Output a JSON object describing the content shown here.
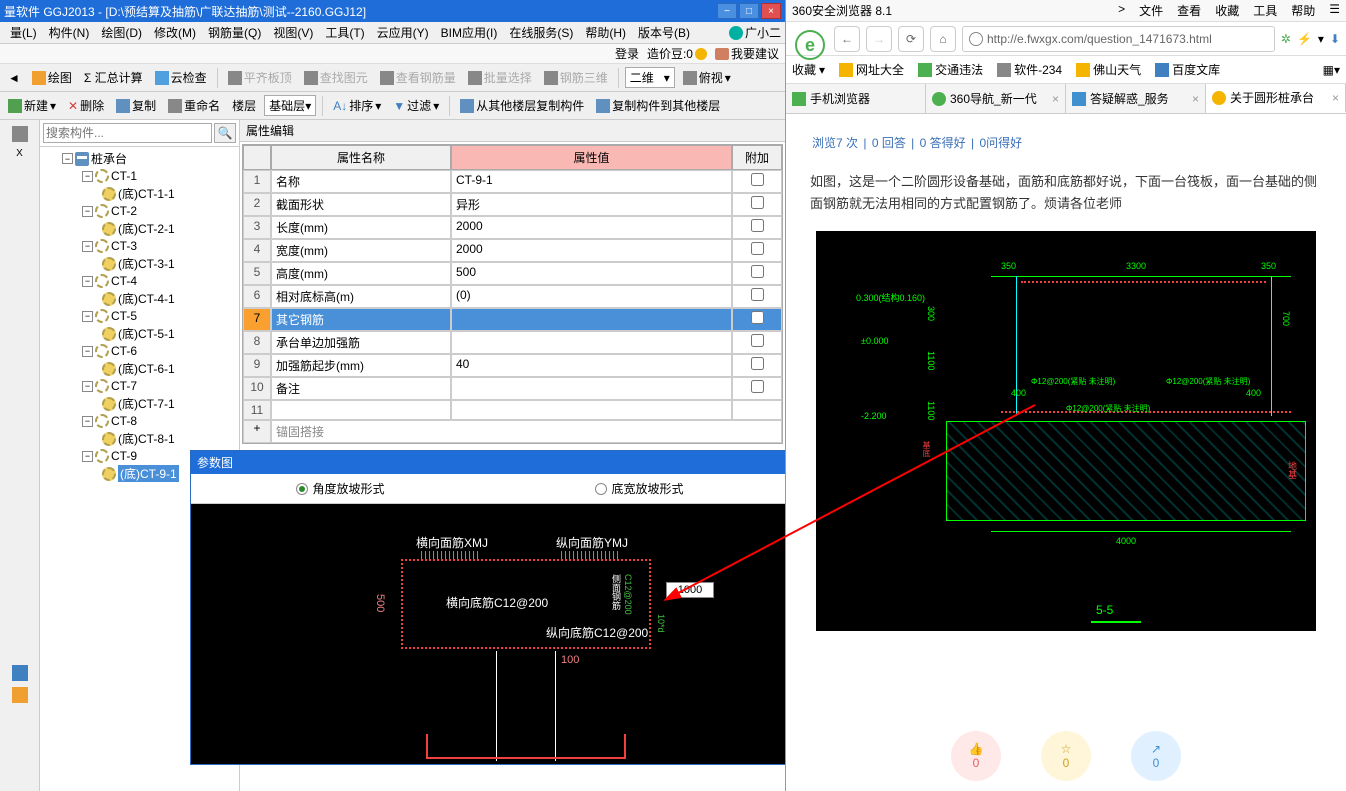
{
  "app": {
    "title": "量软件 GGJ2013 - [D:\\预结算及抽筋\\广联达抽筋\\测试--2160.GGJ12]",
    "menus": [
      "量(L)",
      "构件(N)",
      "绘图(D)",
      "修改(M)",
      "钢筋量(Q)",
      "视图(V)",
      "工具(T)",
      "云应用(Y)",
      "BIM应用(I)",
      "在线服务(S)",
      "帮助(H)",
      "版本号(B)"
    ],
    "xiaoer": "广小二",
    "login": "登录",
    "bean_label": "造价豆:0",
    "suggest": "我要建议"
  },
  "tb1": {
    "draw": "绘图",
    "sum": "Σ 汇总计算",
    "cloud": "云检查",
    "flat": "平齐板顶",
    "find": "查找图元",
    "rebar": "查看钢筋量",
    "batch": "批量选择",
    "tri": "钢筋三维",
    "dim_combo": "二维",
    "view": "俯视"
  },
  "tb2": {
    "new": "新建",
    "del": "删除",
    "copy": "复制",
    "rename": "重命名",
    "floor": "楼层",
    "base_combo": "基础层",
    "sort": "排序",
    "filter": "过滤",
    "copy_from": "从其他楼层复制构件",
    "copy_to": "复制构件到其他楼层"
  },
  "search_placeholder": "搜索构件...",
  "tree": {
    "root": "桩承台",
    "items": [
      {
        "n": "CT-1",
        "c": "(底)CT-1-1"
      },
      {
        "n": "CT-2",
        "c": "(底)CT-2-1"
      },
      {
        "n": "CT-3",
        "c": "(底)CT-3-1"
      },
      {
        "n": "CT-4",
        "c": "(底)CT-4-1"
      },
      {
        "n": "CT-5",
        "c": "(底)CT-5-1"
      },
      {
        "n": "CT-6",
        "c": "(底)CT-6-1"
      },
      {
        "n": "CT-7",
        "c": "(底)CT-7-1"
      },
      {
        "n": "CT-8",
        "c": "(底)CT-8-1"
      },
      {
        "n": "CT-9",
        "c": "(底)CT-9-1"
      }
    ]
  },
  "prop": {
    "title": "属性编辑",
    "h_name": "属性名称",
    "h_val": "属性值",
    "h_ext": "附加",
    "rows": [
      {
        "n": "名称",
        "v": "CT-9-1"
      },
      {
        "n": "截面形状",
        "v": "异形"
      },
      {
        "n": "长度(mm)",
        "v": "2000"
      },
      {
        "n": "宽度(mm)",
        "v": "2000"
      },
      {
        "n": "高度(mm)",
        "v": "500"
      },
      {
        "n": "相对底标高(m)",
        "v": "(0)"
      },
      {
        "n": "其它钢筋",
        "v": ""
      },
      {
        "n": "承台单边加强筋",
        "v": ""
      },
      {
        "n": "加强筋起步(mm)",
        "v": "40"
      },
      {
        "n": "备注",
        "v": ""
      }
    ],
    "anchor": "锚固搭接"
  },
  "param": {
    "title": "参数图",
    "tab1": "角度放坡形式",
    "tab2": "底宽放坡形式",
    "hx_mj": "横向面筋",
    "xmj": "XMJ",
    "zx_mj": "纵向面筋",
    "ymj": "YMJ",
    "hx_dj": "横向底筋",
    "hx_dj_v": "C12@200",
    "zx_dj": "纵向底筋",
    "zx_dj_v": "C12@200",
    "dim_h": "500",
    "dim_v2": "100",
    "side_label": "侧面钢筋",
    "side_v": "C12@200",
    "extra": "10*d",
    "input": "1000"
  },
  "browser": {
    "name": "360安全浏览器 8.1",
    "menu": [
      "文件",
      "查看",
      "收藏",
      "工具",
      "帮助"
    ],
    "url": "http://e.fwxgx.com/question_1471673.html",
    "bm_fav": "收藏",
    "bm": [
      {
        "l": "网址大全",
        "c": "#f5b400"
      },
      {
        "l": "交通违法",
        "c": "#4caf50"
      },
      {
        "l": "软件-234",
        "c": "#888"
      },
      {
        "l": "佛山天气",
        "c": "#f5b400"
      },
      {
        "l": "百度文库",
        "c": "#4080c0"
      }
    ],
    "tabs": [
      {
        "l": "手机浏览器",
        "i": "#4caf50"
      },
      {
        "l": "360导航_新一代",
        "i": "#4caf50"
      },
      {
        "l": "答疑解惑_服务",
        "i": "#4090d0"
      },
      {
        "l": "关于圆形桩承台",
        "i": "#f5b400"
      }
    ],
    "stats": {
      "browse": "浏览7 次",
      "ans": "0 回答",
      "good": "0 答得好",
      "ask": "0问得好"
    },
    "article": "如图，这是一个二阶圆形设备基础，面筋和底筋都好说，下面一台筏板，面一台基础的侧面钢筋就无法用相同的方式配置钢筋了。烦请各位老师",
    "cad": {
      "d1": "350",
      "d2": "3300",
      "d3": "350",
      "lev1": "0.300(结构0.160)",
      "lev2": "±0.000",
      "lev3": "-2.200",
      "h1": "300",
      "h2": "1100",
      "h3": "1100",
      "h4": "700",
      "r1": "Φ12@200(紧贴 未注明)",
      "r2": "Φ12@200(紧贴 未注明)",
      "r3": "Φ12@200(紧贴 未注明)",
      "e1": "400",
      "e2": "400",
      "base": "4000",
      "sec": "5-5",
      "soil": "地基"
    },
    "actions": {
      "like": "0",
      "fav": "0",
      "share": "0"
    }
  }
}
